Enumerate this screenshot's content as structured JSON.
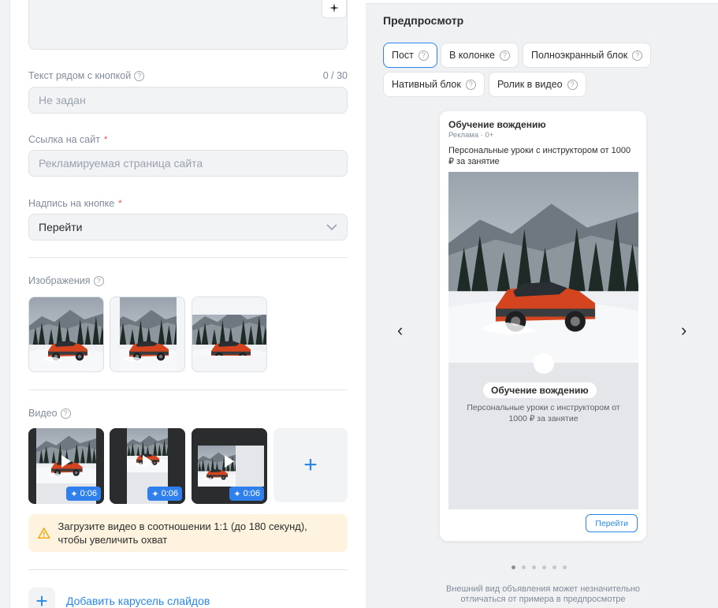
{
  "form": {
    "text_near_button": {
      "label": "Текст рядом с кнопкой",
      "counter": "0 / 30",
      "placeholder": "Не задан"
    },
    "site_link": {
      "label": "Ссылка на сайт",
      "required_mark": "*",
      "placeholder": "Рекламируемая страница сайта"
    },
    "button_caption": {
      "label": "Надпись на кнопке",
      "required_mark": "*",
      "value": "Перейти"
    },
    "images": {
      "label": "Изображения"
    },
    "video": {
      "label": "Видео",
      "durations": [
        "0:06",
        "0:06",
        "0:06"
      ],
      "add_symbol": "+"
    },
    "warning": {
      "text": "Загрузите видео в соотношении 1:1 (до 180 секунд), чтобы увеличить охват"
    },
    "add_carousel": {
      "label": "Добавить карусель слайдов",
      "symbol": "+"
    }
  },
  "preview": {
    "title": "Предпросмотр",
    "tabs": [
      {
        "label": "Пост",
        "active": true
      },
      {
        "label": "В колонке",
        "active": false
      },
      {
        "label": "Полноэкранный блок",
        "active": false
      },
      {
        "label": "Нативный блок",
        "active": false
      },
      {
        "label": "Ролик в видео",
        "active": false
      }
    ],
    "card": {
      "title": "Обучение вождению",
      "sub": "Реклама · 0+",
      "desc": "Персональные уроки с инструктором от 1000 ₽ за занятие",
      "media_heading": "Обучение вождению",
      "media_text": "Персональные уроки с инструктором от 1000 ₽ за занятие",
      "button": "Перейти"
    },
    "prev_arrow": "‹",
    "next_arrow": "›",
    "note": "Внешний вид объявления может незначительно отличаться от примера в предпросмотре"
  },
  "icons": {
    "help": "?",
    "ai": "sparkle-icon",
    "warning": "warning-icon",
    "chevron": "chevron-down-icon"
  },
  "colors": {
    "accent": "#2688eb",
    "warning_bg": "#fdf3de",
    "duration_badge": "#2f80ed"
  }
}
